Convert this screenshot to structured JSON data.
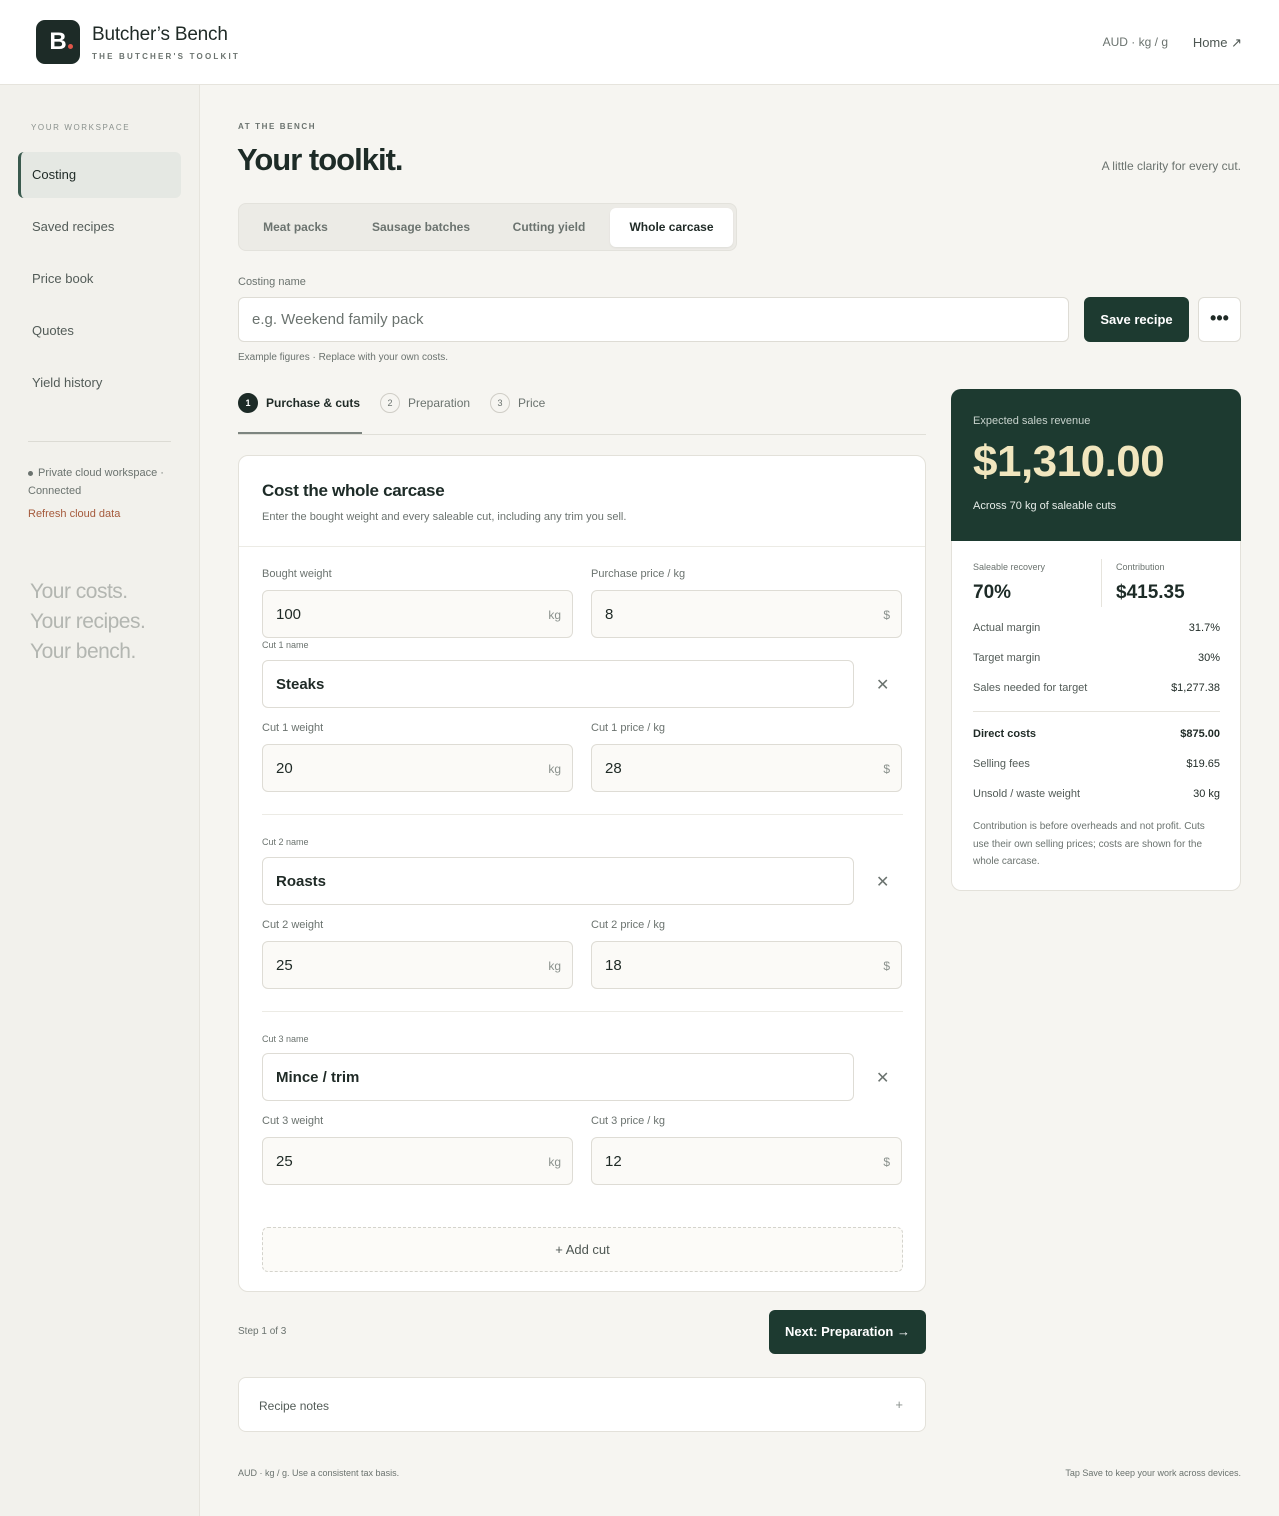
{
  "header": {
    "logo_letter": "B",
    "brand_name": "Butcher’s Bench",
    "brand_tagline": "THE BUTCHER'S TOOLKIT",
    "units": "AUD · kg / g",
    "home_link": "Home ↗"
  },
  "sidebar": {
    "workspace_label": "YOUR WORKSPACE",
    "items": [
      {
        "label": "Costing",
        "active": true
      },
      {
        "label": "Saved recipes",
        "active": false
      },
      {
        "label": "Price book",
        "active": false
      },
      {
        "label": "Quotes",
        "active": false
      },
      {
        "label": "Yield history",
        "active": false
      }
    ],
    "status": "Private cloud workspace · Connected",
    "refresh": "Refresh cloud data",
    "tagline": [
      "Your costs.",
      "Your recipes.",
      "Your bench."
    ]
  },
  "main": {
    "eyebrow": "AT THE BENCH",
    "title": "Your toolkit.",
    "subtitle": "A little clarity for every cut.",
    "tabs": [
      {
        "label": "Meat packs",
        "active": false
      },
      {
        "label": "Sausage batches",
        "active": false
      },
      {
        "label": "Cutting yield",
        "active": false
      },
      {
        "label": "Whole carcase",
        "active": true
      }
    ],
    "costing_name_label": "Costing name",
    "costing_name_placeholder": "e.g. Weekend family pack",
    "save_label": "Save recipe",
    "more_label": "•••",
    "example_note": "Example figures · Replace with your own costs.",
    "steps": [
      {
        "num": "1",
        "label": "Purchase & cuts",
        "active": true
      },
      {
        "num": "2",
        "label": "Preparation",
        "active": false
      },
      {
        "num": "3",
        "label": "Price",
        "active": false
      }
    ],
    "card": {
      "title": "Cost the whole carcase",
      "subtitle": "Enter the bought weight and every saleable cut, including any trim you sell.",
      "bought_weight_label": "Bought weight",
      "bought_weight": "100",
      "bought_weight_unit": "kg",
      "purchase_price_label": "Purchase price / kg",
      "purchase_price": "8",
      "currency": "$",
      "cuts": [
        {
          "name_label": "Cut 1 name",
          "name": "Steaks",
          "weight_label": "Cut 1 weight",
          "weight": "20",
          "price_label": "Cut 1 price / kg",
          "price": "28"
        },
        {
          "name_label": "Cut 2 name",
          "name": "Roasts",
          "weight_label": "Cut 2 weight",
          "weight": "25",
          "price_label": "Cut 2 price / kg",
          "price": "18"
        },
        {
          "name_label": "Cut 3 name",
          "name": "Mince / trim",
          "weight_label": "Cut 3 weight",
          "weight": "25",
          "price_label": "Cut 3 price / kg",
          "price": "12"
        }
      ],
      "remove_glyph": "✕",
      "add_cut": "+ Add cut"
    },
    "step_count": "Step 1 of 3",
    "next_label": "Next: Preparation →",
    "notes_label": "Recipe notes",
    "notes_plus": "+",
    "footer_left": "AUD · kg / g. Use a consistent tax basis.",
    "footer_right": "Tap Save to keep your work across devices."
  },
  "summary": {
    "revenue_label": "Expected sales revenue",
    "revenue": "$1,310.00",
    "revenue_sub": "Across 70 kg of saleable cuts",
    "recovery_label": "Saleable recovery",
    "recovery": "70%",
    "contribution_label": "Contribution",
    "contribution": "$415.35",
    "rows": [
      {
        "label": "Actual margin",
        "value": "31.7%"
      },
      {
        "label": "Target margin",
        "value": "30%"
      },
      {
        "label": "Sales needed for target",
        "value": "$1,277.38"
      }
    ],
    "rows2": [
      {
        "label": "Direct costs",
        "value": "$875.00"
      },
      {
        "label": "Selling fees",
        "value": "$19.65"
      },
      {
        "label": "Unsold / waste weight",
        "value": "30 kg"
      }
    ],
    "fine_print": "Contribution is before overheads and not profit. Cuts use their own selling prices; costs are shown for the whole carcase."
  },
  "colors": {
    "brand_dark": "#1d3a30",
    "revenue_text": "#f1e6be",
    "accent_link": "#a55a3c"
  }
}
